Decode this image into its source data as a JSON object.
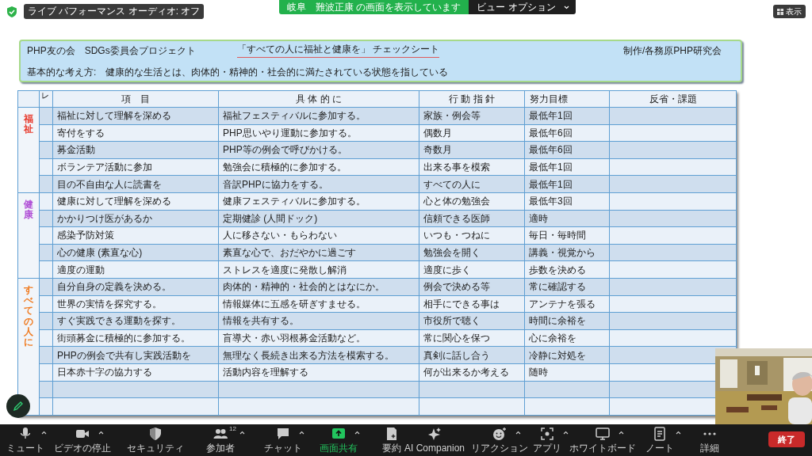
{
  "top_bar": {
    "audio_status": "ライブ パフォーマンス オーディオ: オフ",
    "share_banner": "岐阜　難波正康 の画面を表示しています",
    "view_options": "ビュー オプション",
    "view_button": "表示"
  },
  "document": {
    "header": {
      "org": "PHP友の会　SDGs委員会プロジェクト",
      "title": "「すべての人に福祉と健康を」 チェックシート",
      "author": "制作/各務原PHP研究会",
      "principle": "基本的な考え方:　健康的な生活とは、肉体的・精神的・社会的に満たされている状態を指している"
    },
    "table": {
      "columns": [
        "レ",
        "項　目",
        "具 体 的 に",
        "行 動 指 針",
        "努力目標",
        "反省・課題"
      ],
      "groups": [
        {
          "label": "福祉",
          "color": "#e8382a",
          "rows": [
            [
              "福祉に対して理解を深める",
              "福祉フェスティバルに参加する。",
              "家族・例会等",
              "最低年1回"
            ],
            [
              "寄付をする",
              "PHP思いやり運動に参加する。",
              "偶数月",
              "最低年6回"
            ],
            [
              "募金活動",
              "PHP等の例会で呼びかける。",
              "奇数月",
              "最低年6回"
            ],
            [
              "ボランテア活動に参加",
              "勉強会に積極的に参加する。",
              "出来る事を模索",
              "最低年1回"
            ],
            [
              "目の不自由な人に読書を",
              "音訳PHPに協力をする。",
              "すべての人に",
              "最低年1回"
            ]
          ]
        },
        {
          "label": "健康",
          "color": "#b04fd6",
          "rows": [
            [
              "健康に対して理解を深める",
              "健康フェスティバルに参加する。",
              "心と体の勉強会",
              "最低年3回"
            ],
            [
              "かかりつけ医があるか",
              "定期健診 (人間ドック)",
              "信頼できる医師",
              "適時"
            ],
            [
              "感染予防対策",
              "人に移さない・もらわない",
              "いつも・つねに",
              "毎日・毎時間"
            ],
            [
              "心の健康 (素直な心)",
              "素直な心で、おだやかに過ごす",
              "勉強会を開く",
              "講義・視覚から"
            ],
            [
              "適度の運動",
              "ストレスを適度に発散し解消",
              "適度に歩く",
              "歩数を決める"
            ]
          ]
        },
        {
          "label": "すべての人に",
          "color": "#f07c22",
          "rows": [
            [
              "自分自身の定義を決める。",
              "肉体的・精神的・社会的とはなにか。",
              "例会で決める等",
              "常に確認する"
            ],
            [
              "世界の実情を探究する。",
              "情報媒体に五感を研ぎすませる。",
              "相手にできる事は",
              "アンテナを張る"
            ],
            [
              "すぐ実践できる運動を探す。",
              "情報を共有する。",
              "市役所で聴く",
              "時間に余裕を"
            ],
            [
              "街頭募金に積極的に参加する。",
              "盲導犬・赤い羽根募金活動など。",
              "常に関心を保つ",
              "心に余裕を"
            ],
            [
              "PHPの例会で共有し実践活動を",
              "無理なく長続き出来る方法を模索する。",
              "真剣に話し合う",
              "冷静に対処を"
            ],
            [
              "日本赤十字の協力する",
              "活動内容を理解する",
              "何が出来るか考える",
              "随時"
            ]
          ]
        }
      ]
    }
  },
  "toolbar": {
    "items": [
      {
        "kind": "mic",
        "label": "ミュート",
        "caret": true,
        "active": false
      },
      {
        "kind": "video",
        "label": "ビデオの停止",
        "caret": true,
        "active": false
      },
      {
        "kind": "security",
        "label": "セキュリティ",
        "caret": false,
        "active": false
      },
      {
        "kind": "participants",
        "label": "参加者",
        "count": "12",
        "caret": true,
        "active": false
      },
      {
        "kind": "chat",
        "label": "チャット",
        "caret": true,
        "active": false
      },
      {
        "kind": "share",
        "label": "画面共有",
        "caret": true,
        "active": true
      },
      {
        "kind": "summary",
        "label": "要約",
        "caret": false,
        "active": false
      },
      {
        "kind": "ai",
        "label": "AI Companion",
        "caret": false,
        "active": false
      },
      {
        "kind": "reaction",
        "label": "リアクション",
        "caret": true,
        "active": false
      },
      {
        "kind": "apps",
        "label": "アプリ",
        "caret": true,
        "active": false
      },
      {
        "kind": "whiteboard",
        "label": "ホワイトボード",
        "caret": true,
        "active": false
      },
      {
        "kind": "notes",
        "label": "ノート",
        "caret": true,
        "active": false
      },
      {
        "kind": "more",
        "label": "詳細",
        "caret": false,
        "active": false
      }
    ],
    "end_button": "終了"
  }
}
